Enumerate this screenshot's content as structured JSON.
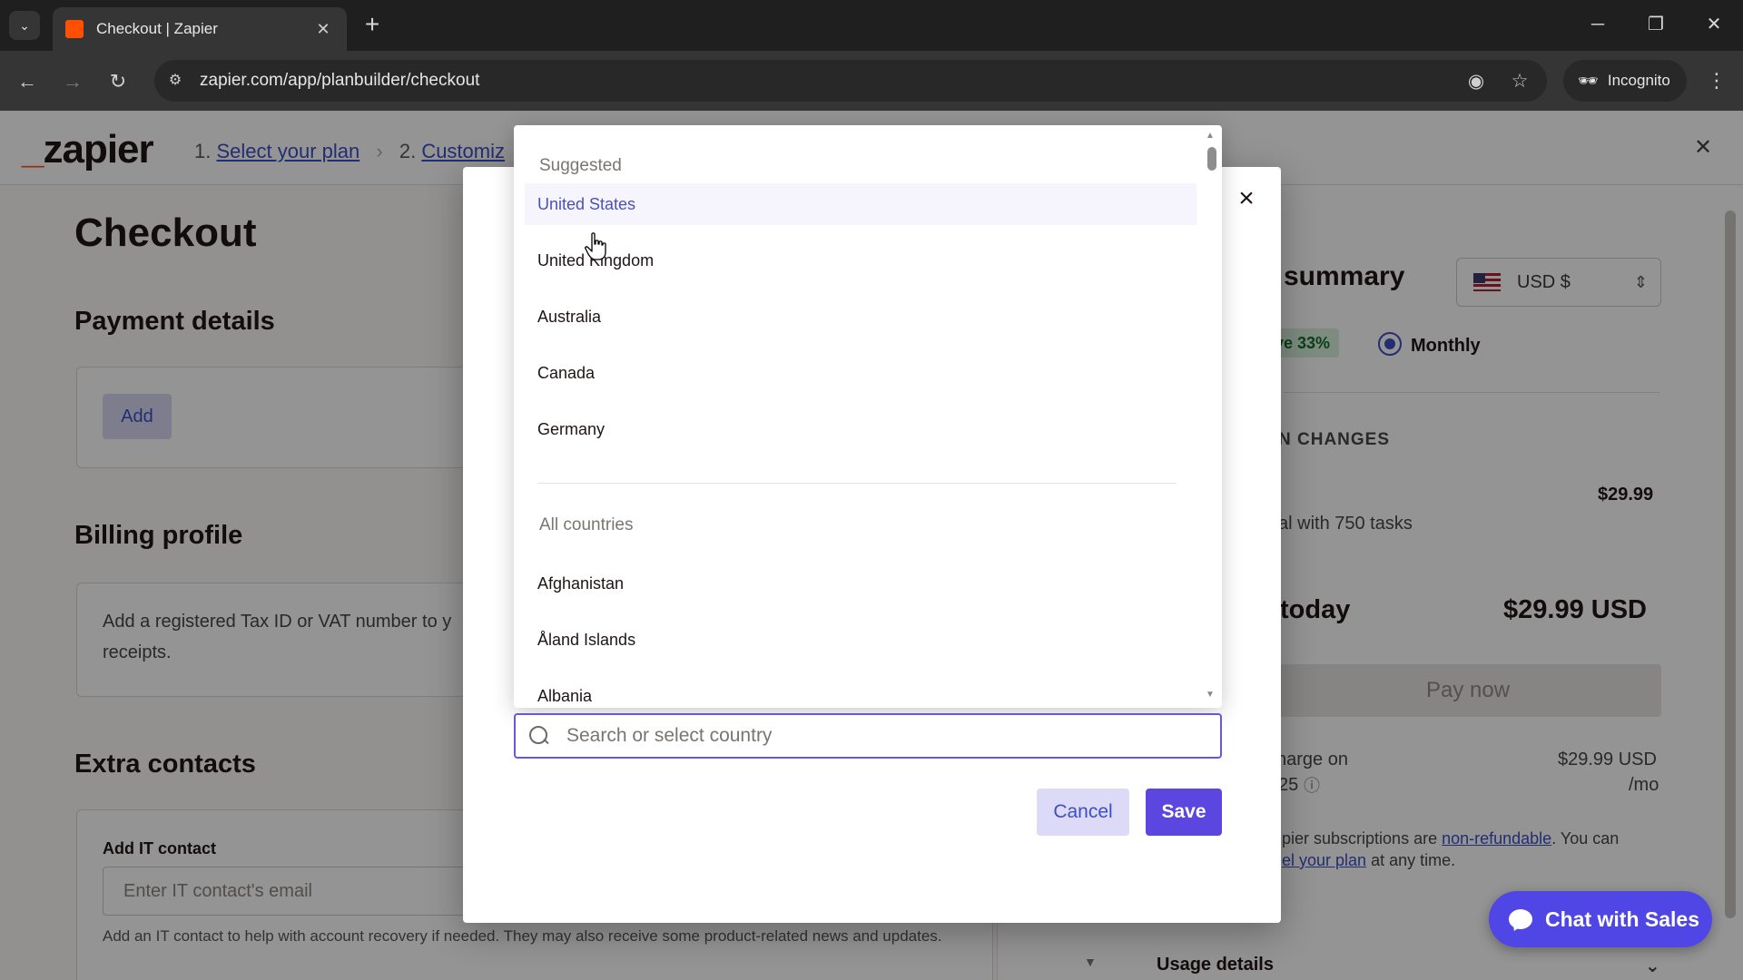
{
  "browser": {
    "tab_title": "Checkout | Zapier",
    "url": "zapier.com/app/planbuilder/checkout",
    "incognito_label": "Incognito"
  },
  "header": {
    "logo_text": "zapier",
    "step1_prefix": "1.",
    "step1_link": "Select your plan",
    "step2_prefix": "2.",
    "step2_link": "Customiz"
  },
  "page": {
    "title": "Checkout",
    "payment_heading": "Payment details",
    "add_button": "Add",
    "billing_heading": "Billing profile",
    "billing_text": "Add a registered Tax ID or VAT number to y",
    "billing_text2": "receipts.",
    "contacts_heading": "Extra contacts",
    "it_contact_label": "Add IT contact",
    "it_contact_placeholder": "Enter IT contact's email",
    "it_contact_help": "Add an IT contact to help with account recovery if needed. They may also receive some product-related news and updates."
  },
  "summary": {
    "title": "summary",
    "currency": "USD $",
    "save_badge": "ve 33%",
    "billing_period": "Monthly",
    "section_label": "N CHANGES",
    "plan_price": "$29.99",
    "plan_detail": "al with 750 tasks",
    "due_label": "today",
    "due_amount": "$29.99 USD",
    "pay_button": "Pay now",
    "next_charge_label": "harge on",
    "next_charge_date": "25",
    "next_charge_amount": "$29.99 USD",
    "next_charge_period": "/mo",
    "refund_text_a": "pier subscriptions are ",
    "refund_link": "non-refundable",
    "refund_text_b": ". You can",
    "cancel_link": "el your plan",
    "refund_text_c": " at any time.",
    "usage_details": "Usage details"
  },
  "country_picker": {
    "suggested_heading": "Suggested",
    "suggested": [
      "United States",
      "United Kingdom",
      "Australia",
      "Canada",
      "Germany"
    ],
    "all_heading": "All countries",
    "all": [
      "Afghanistan",
      "Åland Islands",
      "Albania"
    ],
    "search_placeholder": "Search or select country",
    "cancel_button": "Cancel",
    "save_button": "Save",
    "highlighted": "United States"
  },
  "chat": {
    "label": "Chat with Sales"
  },
  "colors": {
    "brand_orange": "#ff4f00",
    "accent_purple": "#5b47e0",
    "link_blue": "#3d4fc4"
  }
}
